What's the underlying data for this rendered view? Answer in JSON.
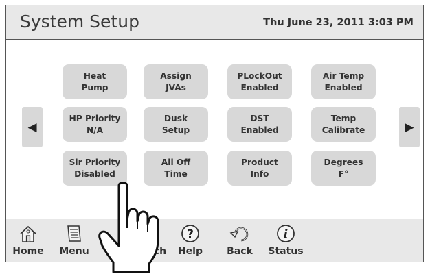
{
  "header": {
    "title": "System Setup",
    "datetime": "Thu June 23, 2011  3:03 PM"
  },
  "grid": [
    {
      "line1": "Heat",
      "line2": "Pump"
    },
    {
      "line1": "Assign",
      "line2": "JVAs"
    },
    {
      "line1": "PLockOut",
      "line2": "Enabled"
    },
    {
      "line1": "Air Temp",
      "line2": "Enabled"
    },
    {
      "line1": "HP Priority",
      "line2": "N/A"
    },
    {
      "line1": "Dusk",
      "line2": "Setup"
    },
    {
      "line1": "DST",
      "line2": "Enabled"
    },
    {
      "line1": "Temp",
      "line2": "Calibrate"
    },
    {
      "line1": "Slr Priority",
      "line2": "Disabled"
    },
    {
      "line1": "All Off",
      "line2": "Time"
    },
    {
      "line1": "Product",
      "line2": "Info"
    },
    {
      "line1": "Degrees",
      "line2": "F°"
    }
  ],
  "arrows": {
    "left": "◀",
    "right": "▶"
  },
  "footer": [
    {
      "label": "Home",
      "icon": "home-icon"
    },
    {
      "label": "Menu",
      "icon": "menu-icon"
    },
    {
      "label": "ch",
      "icon": "search-icon"
    },
    {
      "label": "Help",
      "icon": "help-icon"
    },
    {
      "label": "Back",
      "icon": "back-icon"
    },
    {
      "label": "Status",
      "icon": "status-icon"
    }
  ],
  "colors": {
    "button": "#d8d8d8",
    "header": "#e8e8e8",
    "border": "#555555"
  }
}
